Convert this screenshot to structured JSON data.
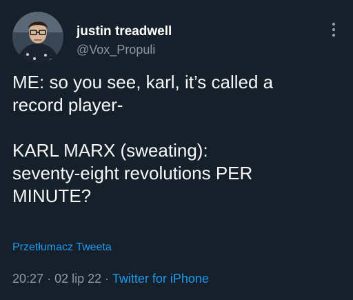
{
  "tweet": {
    "author": {
      "display_name": "justin treadwell",
      "handle": "@Vox_Propuli"
    },
    "text_lines": [
      "ME: so you see, karl, it’s called a",
      "record player-",
      "",
      "KARL MARX (sweating):",
      "seventy-eight revolutions PER",
      "MINUTE?"
    ],
    "translate_label": "Przetłumacz Tweeta",
    "time": "20:27",
    "date": "02 lip 22",
    "separator": "·",
    "source": "Twitter for iPhone"
  },
  "icons": {
    "more": "more-vertical-icon"
  },
  "colors": {
    "background": "#15202b",
    "primary_text": "#ffffff",
    "secondary_text": "#8b98a5",
    "accent": "#1d9bf0"
  }
}
